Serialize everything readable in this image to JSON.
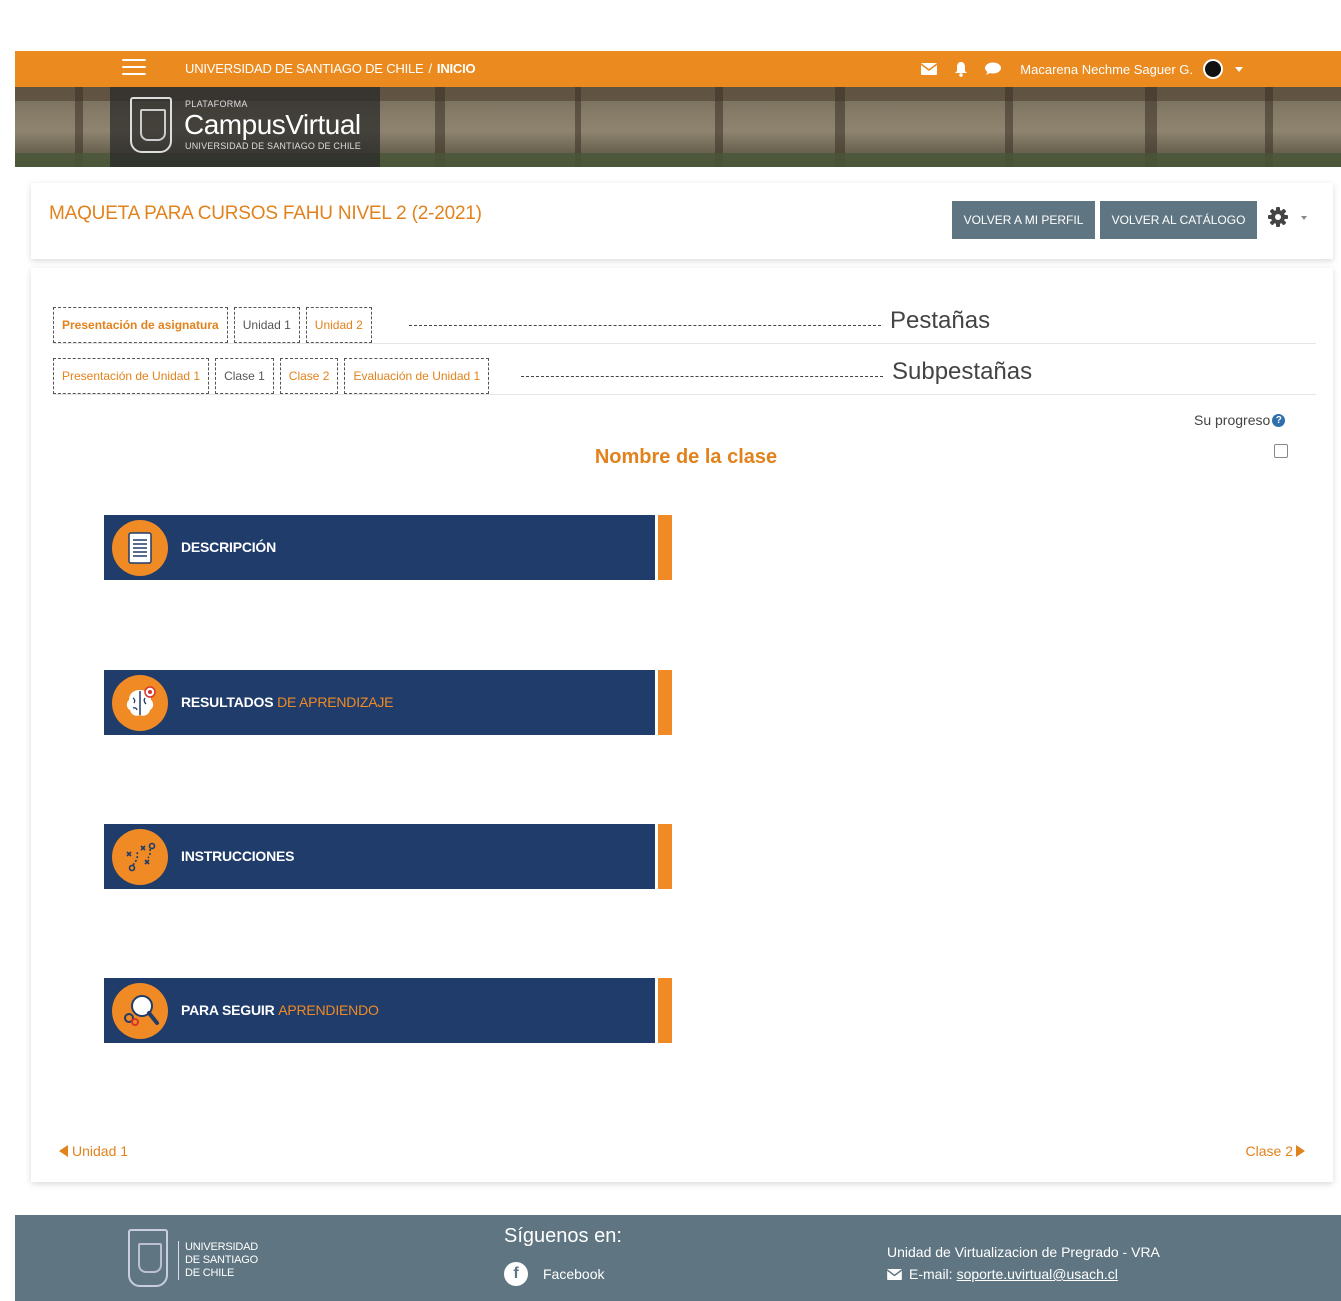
{
  "topbar": {
    "university": "UNIVERSIDAD DE SANTIAGO DE CHILE",
    "separator": "/",
    "home": "INICIO",
    "user_name": "Macarena Nechme Saguer G."
  },
  "banner": {
    "platform_label": "PLATAFORMA",
    "brand_part1": "Campus",
    "brand_part2": "Virtual",
    "brand_sub": "UNIVERSIDAD DE SANTIAGO DE CHILE"
  },
  "course": {
    "title": "MAQUETA PARA CURSOS FAHU NIVEL 2 (2-2021)",
    "btn_profile": "VOLVER A MI PERFIL",
    "btn_catalog": "VOLVER AL CATÁLOGO"
  },
  "tabs": [
    {
      "label": "Presentación de asignatura"
    },
    {
      "label": "Unidad 1"
    },
    {
      "label": "Unidad 2"
    }
  ],
  "tabs_hint": "Pestañas",
  "subtabs": [
    {
      "label": "Presentación de Unidad 1"
    },
    {
      "label": "Clase 1"
    },
    {
      "label": "Clase 2"
    },
    {
      "label": "Evaluación de Unidad 1"
    }
  ],
  "subtabs_hint": "Subpestañas",
  "progress": {
    "label": "Su progreso",
    "help": "?"
  },
  "class_title": "Nombre de la clase",
  "sections": [
    {
      "label_bold": "DESCRIPCIÓN",
      "label_light": ""
    },
    {
      "label_bold": "RESULTADOS",
      "label_light": "DE APRENDIZAJE"
    },
    {
      "label_bold": "INSTRUCCIONES",
      "label_light": ""
    },
    {
      "label_bold": "PARA SEGUIR",
      "label_light": "APRENDIENDO"
    }
  ],
  "nav": {
    "prev": "Unidad 1",
    "next": "Clase 2"
  },
  "footer": {
    "uni_line1": "UNIVERSIDAD",
    "uni_line2": "DE SANTIAGO",
    "uni_line3": "DE CHILE",
    "follow": "Síguenos en:",
    "facebook": "Facebook",
    "unit": "Unidad de Virtualizacion de Pregrado - VRA",
    "email_label": "E-mail:",
    "email": "soporte.uvirtual@usach.cl"
  },
  "colors": {
    "orange": "#ea8a1f",
    "navy": "#1f3c6b",
    "slate": "#5f7682"
  }
}
